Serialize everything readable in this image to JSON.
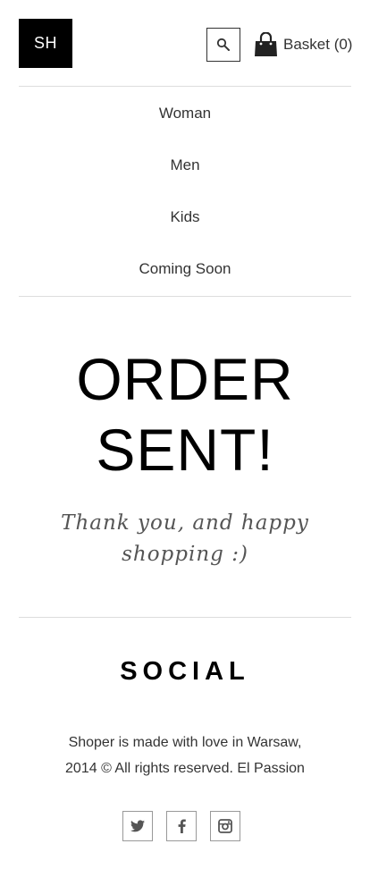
{
  "header": {
    "logo_text": "SH",
    "basket_label": "Basket (0)",
    "icons": {
      "search": "search-icon",
      "basket": "shopping-bag-icon"
    }
  },
  "nav": {
    "items": [
      {
        "label": "Woman"
      },
      {
        "label": "Men"
      },
      {
        "label": "Kids"
      },
      {
        "label": "Coming Soon"
      }
    ]
  },
  "hero": {
    "title_line1": "ORDER",
    "title_line2": "SENT!",
    "subtitle_line1": "Thank you, and happy",
    "subtitle_line2": "shopping :)"
  },
  "social": {
    "title": "SOCIAL",
    "footer_line1": "Shoper is made with love in Warsaw,",
    "footer_line2": "2014 © All rights reserved. El Passion",
    "icons": [
      "twitter-icon",
      "facebook-icon",
      "instagram-icon"
    ]
  }
}
